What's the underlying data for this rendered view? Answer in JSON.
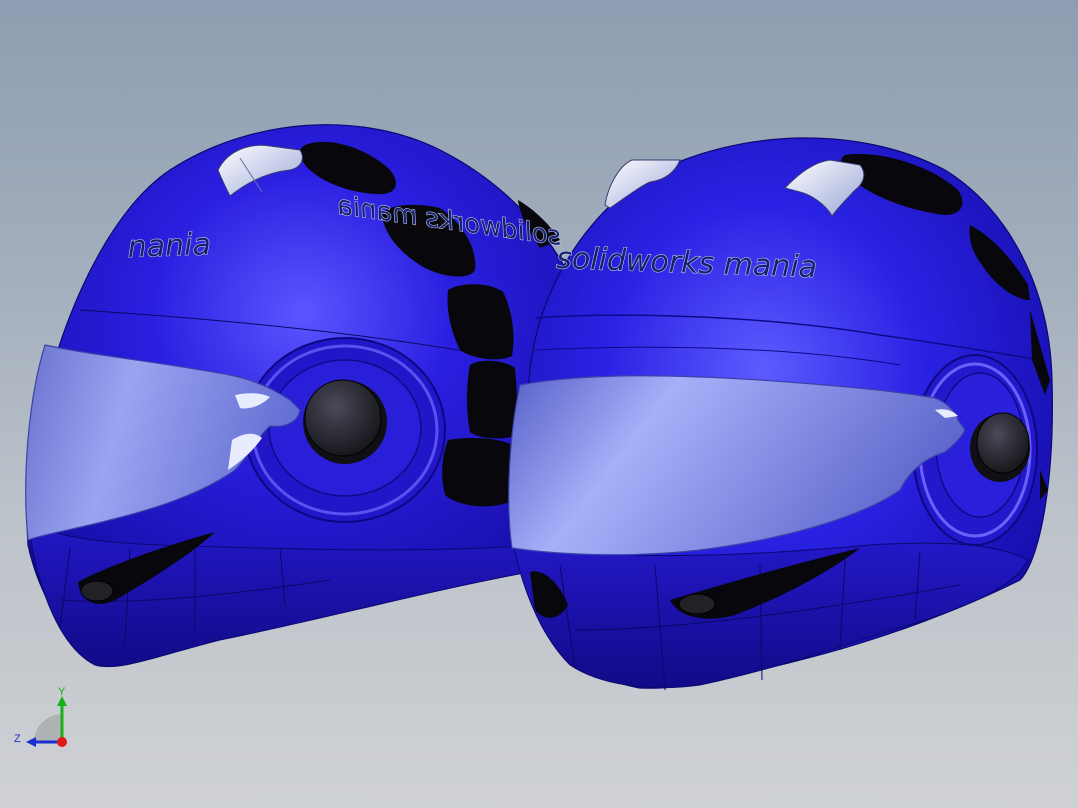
{
  "viewport": {
    "background_top": "#8e9db1",
    "background_bottom": "#cfd1d4"
  },
  "model": {
    "part_color": "#1f16c2",
    "visor_color": "#8e9be6",
    "vent_color": "#0a0a0e",
    "helmets": [
      {
        "decal_text": "nania",
        "mirror_text": "solidworks mania"
      },
      {
        "decal_text": "solidworks mania"
      }
    ]
  },
  "triad": {
    "y_label": "Y",
    "z_label": "Z",
    "x_color": "#e01818",
    "y_color": "#18b018",
    "z_color": "#1830d0"
  }
}
